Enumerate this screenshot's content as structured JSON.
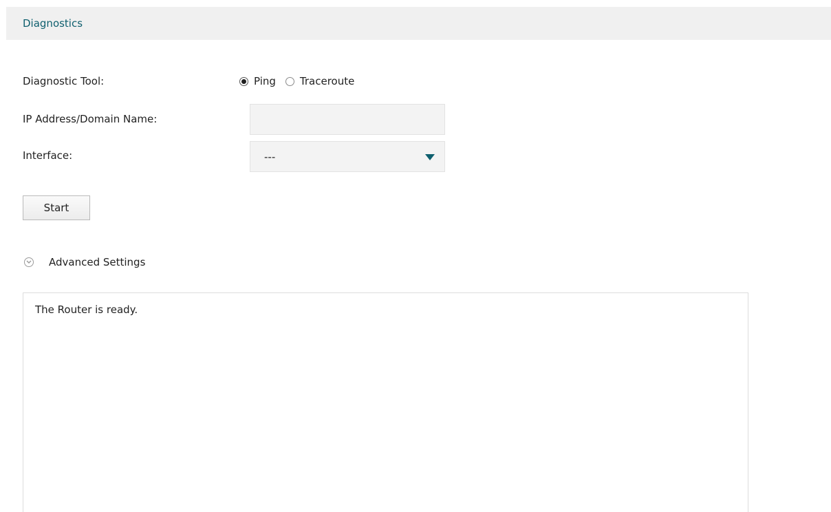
{
  "header": {
    "title": "Diagnostics"
  },
  "form": {
    "tool_label": "Diagnostic Tool:",
    "tool_options": [
      {
        "label": "Ping",
        "selected": true
      },
      {
        "label": "Traceroute",
        "selected": false
      }
    ],
    "ip_label": "IP Address/Domain Name:",
    "ip_value": "",
    "interface_label": "Interface:",
    "interface_value": "---"
  },
  "actions": {
    "start_label": "Start"
  },
  "advanced": {
    "label": "Advanced Settings",
    "icon": "chevron-down-circle-icon"
  },
  "output": {
    "text": "The Router is ready."
  },
  "colors": {
    "accent": "#0e5f6e",
    "header_bg": "#f0f0f0",
    "input_bg": "#f3f3f3"
  }
}
